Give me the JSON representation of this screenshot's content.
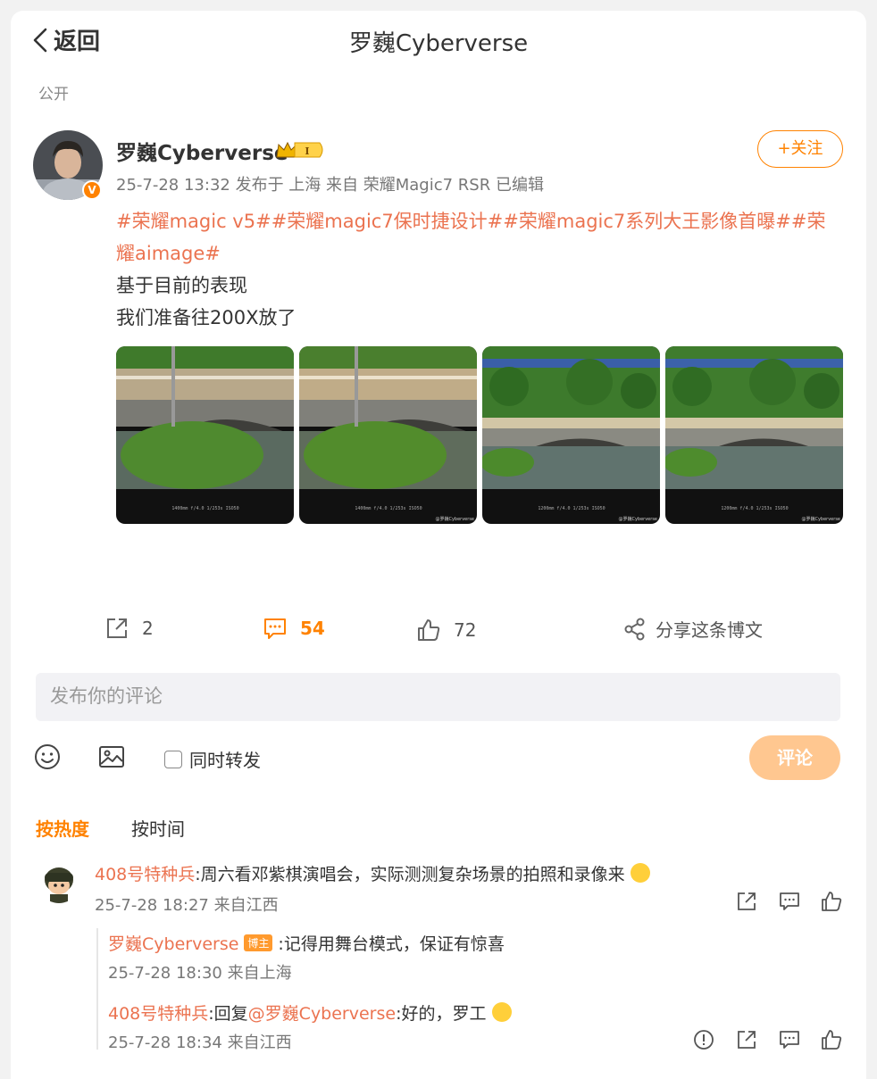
{
  "header": {
    "back_label": "返回",
    "title": "罗巍Cyberverse",
    "visibility": "公开"
  },
  "post": {
    "author": "罗巍Cyberverse",
    "meta": "25-7-28 13:32  发布于 上海  来自 荣耀Magic7 RSR  已编辑",
    "follow_label": "+关注",
    "hashtags_line": "#荣耀magic v5##荣耀magic7保时捷设计##荣耀magic7系列大王影像首曝##荣耀aimage#",
    "line1": "基于目前的表现",
    "line2": "我们准备往200X放了",
    "images": [
      {
        "caption": "1400mm  f/4.0  1/253s  ISO50"
      },
      {
        "caption": "1400mm  f/4.0  1/253s  ISO50",
        "watermark": "@罗巍Cyberverse"
      },
      {
        "caption": "1200mm  f/4.0  1/253s  ISO50",
        "watermark": "@罗巍Cyberverse"
      },
      {
        "caption": "1200mm  f/4.0  1/253s  ISO50",
        "watermark": "@罗巍Cyberverse"
      }
    ]
  },
  "actions": {
    "repost_count": "2",
    "comment_count": "54",
    "like_count": "72",
    "share_label": "分享这条博文"
  },
  "composer": {
    "placeholder": "发布你的评论",
    "repost_label": "同时转发",
    "submit_label": "评论"
  },
  "sort": {
    "hot": "按热度",
    "time": "按时间"
  },
  "comments": [
    {
      "user": "408号特种兵",
      "text": ":周六看邓紫棋演唱会，实际测测复杂场景的拍照和录像来",
      "meta": "25-7-28 18:27 来自江西",
      "replies": [
        {
          "user": "罗巍Cyberverse",
          "badge": "博主",
          "text": ":记得用舞台模式，保证有惊喜",
          "meta": "25-7-28 18:30 来自上海"
        },
        {
          "user": "408号特种兵",
          "reply_prefix": ":回复",
          "mention": "@罗巍Cyberverse",
          "text": ":好的，罗工",
          "meta": "25-7-28 18:34 来自江西"
        }
      ]
    }
  ],
  "colors": {
    "accent": "#ff8200",
    "link": "#eb7350",
    "submit_disabled": "#ffc790"
  }
}
